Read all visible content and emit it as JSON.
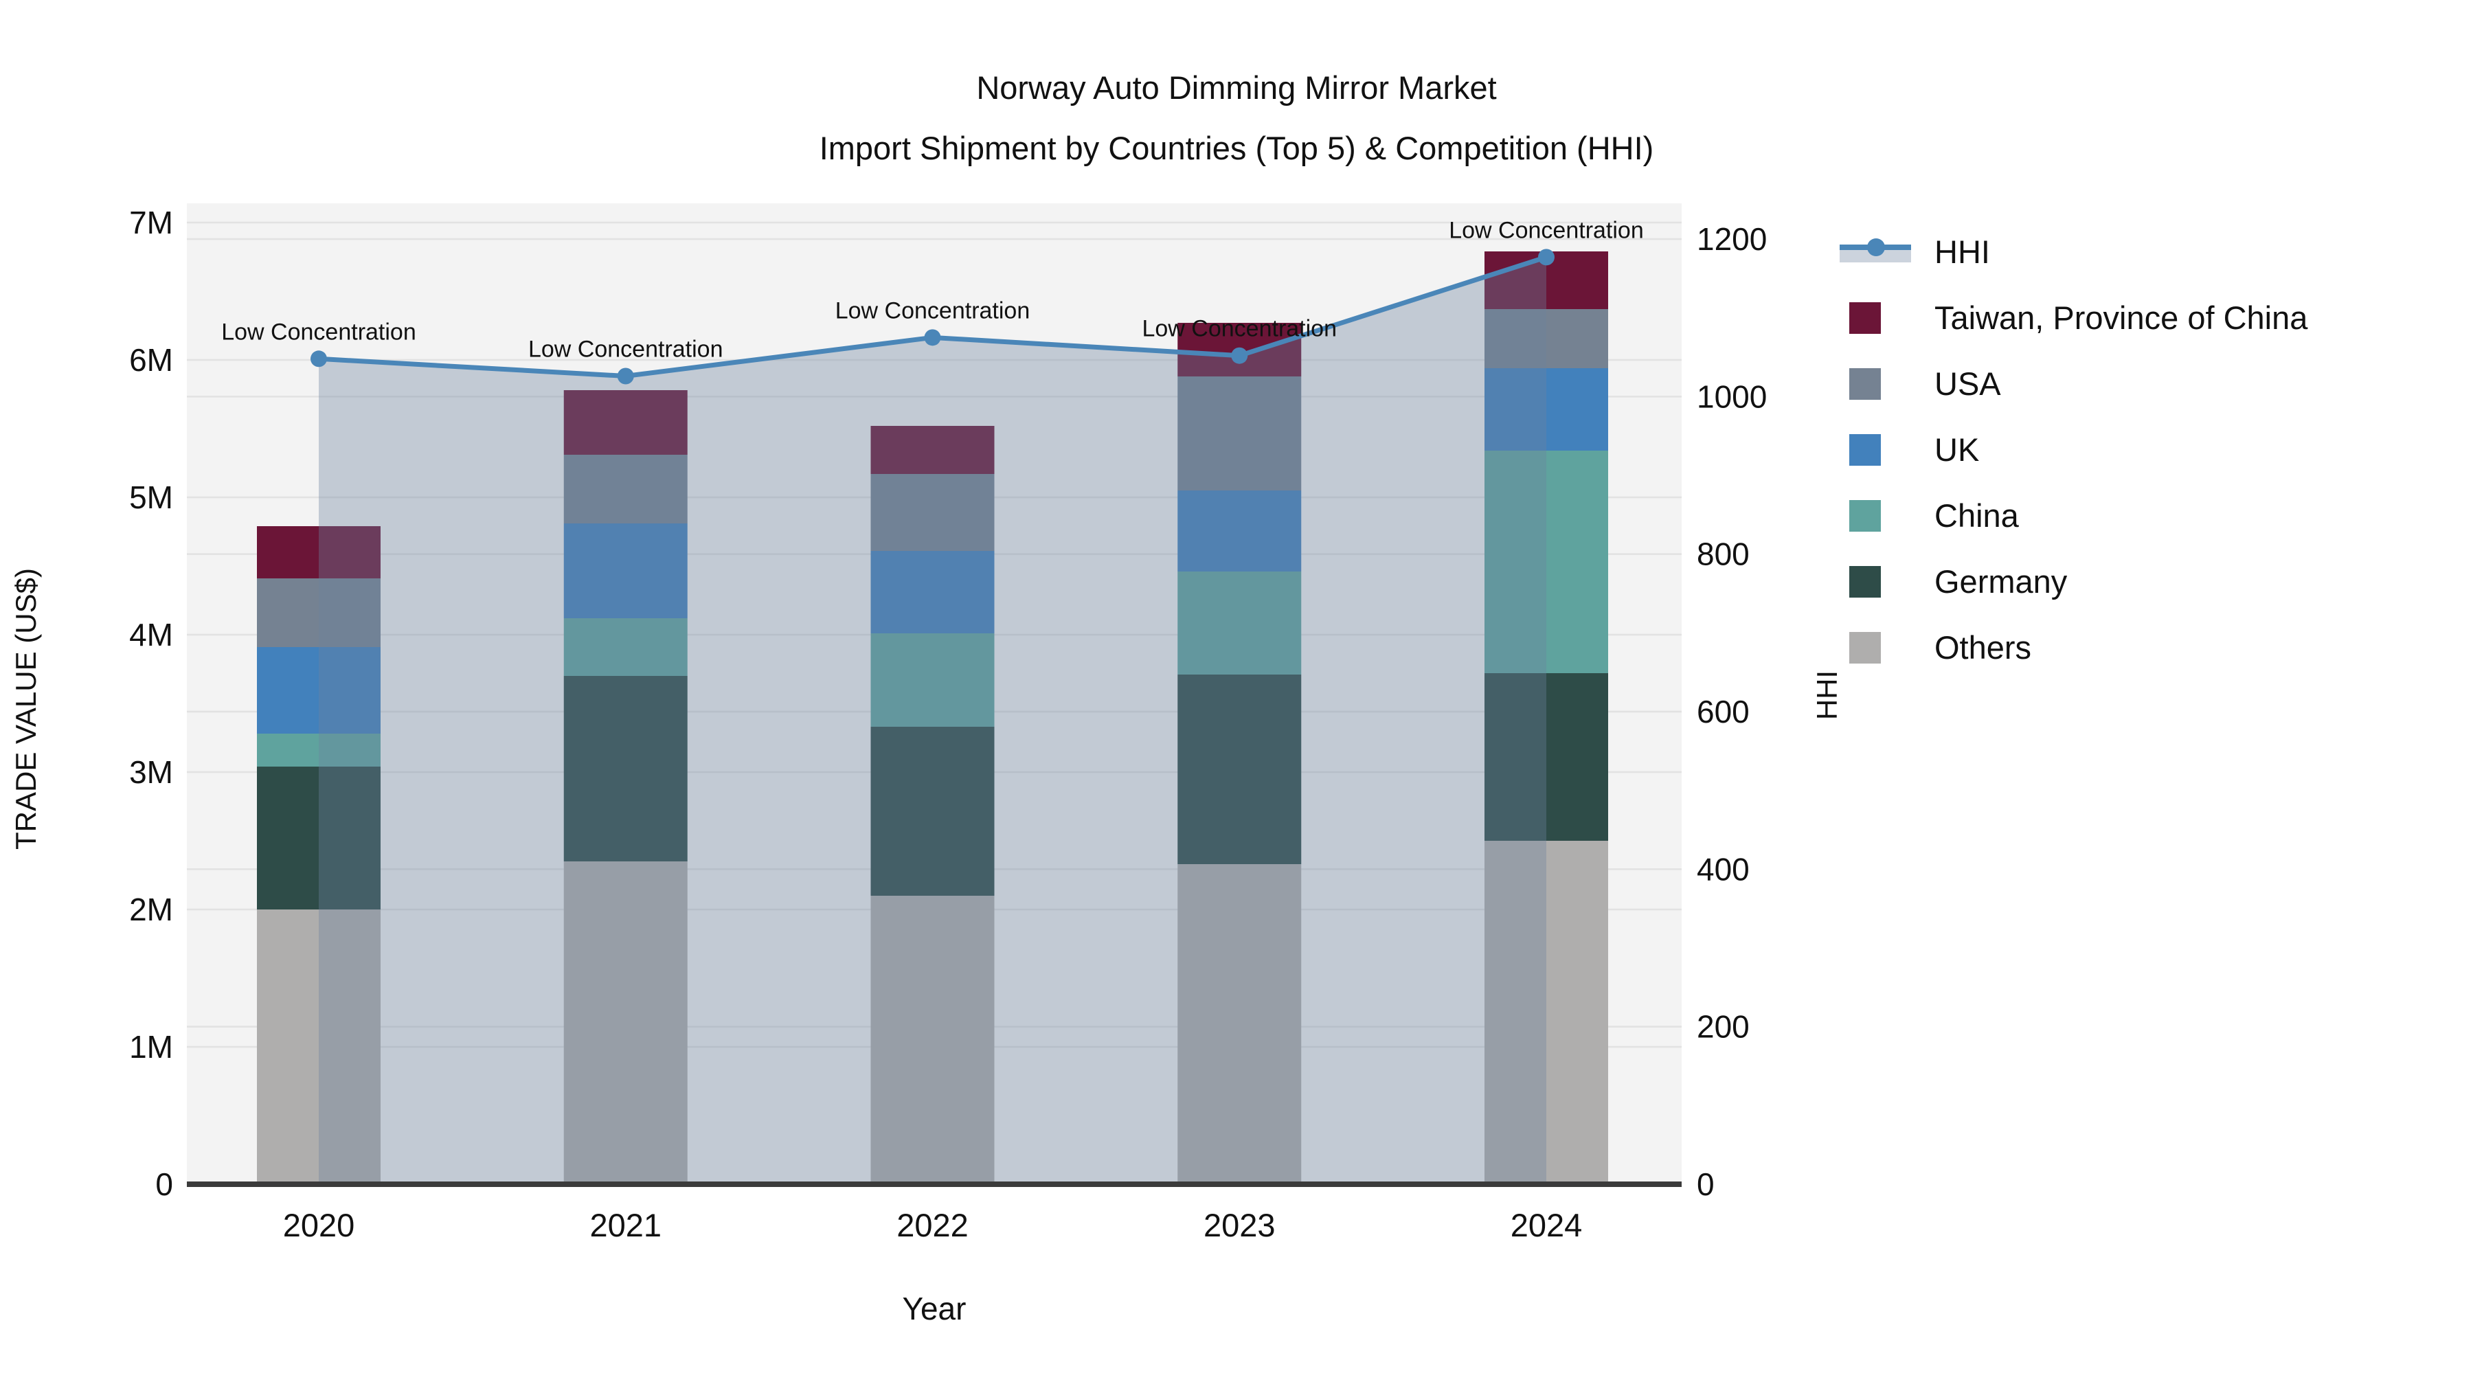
{
  "title": {
    "line1": "Norway Auto Dimming Mirror Market",
    "line2": "Import Shipment by Countries (Top 5) & Competition (HHI)"
  },
  "colors": {
    "background": "#ffffff",
    "plot_background": "#f3f3f3",
    "grid": "#e2e2e2",
    "axis_spine": "#3b3b3b",
    "text": "#111111",
    "hhi_line": "#4a86b8",
    "hhi_area_fill": "rgba(109,129,157,0.36)",
    "legend_band_sample": "#ccd3dd"
  },
  "chart_data": {
    "type": "bar",
    "subtype": "stacked-bars-with-line",
    "unit": "M US$",
    "categories": [
      "2020",
      "2021",
      "2022",
      "2023",
      "2024"
    ],
    "series": [
      {
        "name": "Taiwan, Province of China",
        "color": "#6B1537",
        "values": [
          0.38,
          0.47,
          0.35,
          0.39,
          0.42
        ]
      },
      {
        "name": "USA",
        "color": "#758292",
        "values": [
          0.5,
          0.5,
          0.56,
          0.83,
          0.43
        ]
      },
      {
        "name": "UK",
        "color": "#4281BC",
        "values": [
          0.63,
          0.69,
          0.6,
          0.59,
          0.6
        ]
      },
      {
        "name": "China",
        "color": "#5FA39E",
        "values": [
          0.24,
          0.42,
          0.68,
          0.75,
          1.62
        ]
      },
      {
        "name": "Germany",
        "color": "#2E4C48",
        "values": [
          1.04,
          1.35,
          1.23,
          1.38,
          1.22
        ]
      },
      {
        "name": "Others",
        "color": "#AFAEAD",
        "values": [
          2.0,
          2.35,
          2.1,
          2.33,
          2.5
        ]
      }
    ],
    "bar_totals": [
      4.79,
      5.78,
      5.52,
      6.27,
      6.79
    ],
    "line_series": {
      "name": "HHI",
      "values": [
        1048,
        1026,
        1075,
        1052,
        1177
      ],
      "point_annotation": "Low Concentration"
    },
    "left_axis": {
      "label": "TRADE VALUE (US$)",
      "ticks": [
        "0",
        "1M",
        "2M",
        "3M",
        "4M",
        "5M",
        "6M",
        "7M"
      ],
      "min": 0,
      "max": 7
    },
    "right_axis": {
      "label": "HHI",
      "ticks": [
        "0",
        "200",
        "400",
        "600",
        "800",
        "1000",
        "1200"
      ],
      "min": 0,
      "max": 1200
    },
    "x_axis": {
      "label": "Year"
    },
    "legend": [
      {
        "label": "HHI",
        "type": "line"
      },
      {
        "label": "Taiwan, Province of China",
        "type": "swatch",
        "color": "#6B1537"
      },
      {
        "label": "USA",
        "type": "swatch",
        "color": "#758292"
      },
      {
        "label": "UK",
        "type": "swatch",
        "color": "#4281BC"
      },
      {
        "label": "China",
        "type": "swatch",
        "color": "#5FA39E"
      },
      {
        "label": "Germany",
        "type": "swatch",
        "color": "#2E4C48"
      },
      {
        "label": "Others",
        "type": "swatch",
        "color": "#AFAEAD"
      }
    ],
    "legend_position": "right"
  }
}
